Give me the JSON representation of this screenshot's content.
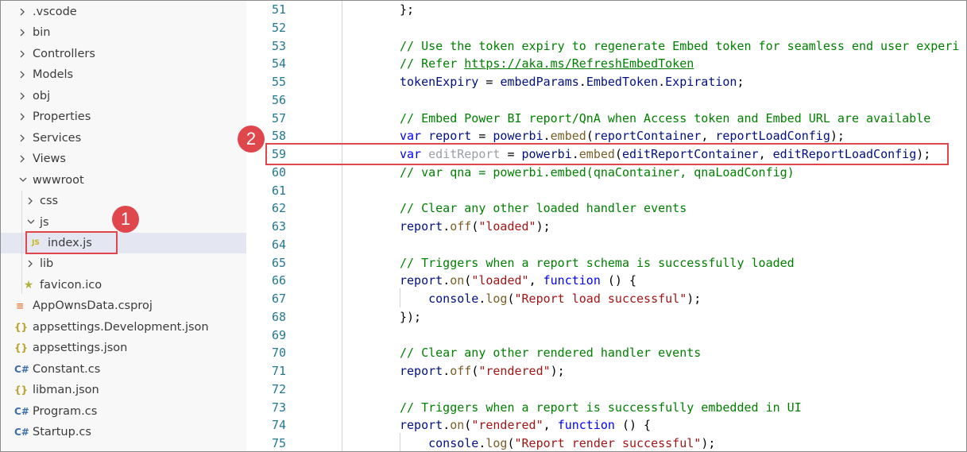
{
  "explorer": {
    "items": [
      {
        "label": ".vscode",
        "kind": "folder",
        "icon": "chevron-right-icon"
      },
      {
        "label": "bin",
        "kind": "folder",
        "icon": "chevron-right-icon"
      },
      {
        "label": "Controllers",
        "kind": "folder",
        "icon": "chevron-right-icon"
      },
      {
        "label": "Models",
        "kind": "folder",
        "icon": "chevron-right-icon"
      },
      {
        "label": "obj",
        "kind": "folder",
        "icon": "chevron-right-icon"
      },
      {
        "label": "Properties",
        "kind": "folder",
        "icon": "chevron-right-icon"
      },
      {
        "label": "Services",
        "kind": "folder",
        "icon": "chevron-right-icon"
      },
      {
        "label": "Views",
        "kind": "folder",
        "icon": "chevron-right-icon"
      },
      {
        "label": "wwwroot",
        "kind": "folder-open",
        "icon": "chevron-down-icon"
      },
      {
        "label": "css",
        "kind": "folder",
        "icon": "chevron-right-icon"
      },
      {
        "label": "js",
        "kind": "folder-open",
        "icon": "chevron-down-icon"
      },
      {
        "label": "index.js",
        "kind": "file",
        "icon": "javascript-file-icon",
        "icon_text": "JS"
      },
      {
        "label": "lib",
        "kind": "folder",
        "icon": "chevron-right-icon"
      },
      {
        "label": "favicon.ico",
        "kind": "file",
        "icon": "star-icon",
        "icon_text": "★"
      },
      {
        "label": "AppOwnsData.csproj",
        "kind": "file",
        "icon": "rss-icon",
        "icon_text": "≡"
      },
      {
        "label": "appsettings.Development.json",
        "kind": "file",
        "icon": "json-braces-icon",
        "icon_text": "{}"
      },
      {
        "label": "appsettings.json",
        "kind": "file",
        "icon": "json-braces-icon",
        "icon_text": "{}"
      },
      {
        "label": "Constant.cs",
        "kind": "file",
        "icon": "csharp-file-icon",
        "icon_text": "C#"
      },
      {
        "label": "libman.json",
        "kind": "file",
        "icon": "json-braces-icon",
        "icon_text": "{}"
      },
      {
        "label": "Program.cs",
        "kind": "file",
        "icon": "csharp-file-icon",
        "icon_text": "C#"
      },
      {
        "label": "Startup.cs",
        "kind": "file",
        "icon": "csharp-file-icon",
        "icon_text": "C#"
      }
    ]
  },
  "editor": {
    "lines": [
      {
        "n": "51",
        "tokens": [
          {
            "t": "};",
            "c": "plain"
          }
        ]
      },
      {
        "n": "52",
        "tokens": []
      },
      {
        "n": "53",
        "tokens": [
          {
            "t": "// Use the token expiry to regenerate Embed token for seamless end user experi",
            "c": "comment"
          }
        ]
      },
      {
        "n": "54",
        "tokens": [
          {
            "t": "// Refer ",
            "c": "comment"
          },
          {
            "t": "https://aka.ms/RefreshEmbedToken",
            "c": "link"
          }
        ]
      },
      {
        "n": "55",
        "tokens": [
          {
            "t": "tokenExpiry",
            "c": "var"
          },
          {
            "t": " = ",
            "c": "plain"
          },
          {
            "t": "embedParams",
            "c": "var"
          },
          {
            "t": ".",
            "c": "plain"
          },
          {
            "t": "EmbedToken",
            "c": "var"
          },
          {
            "t": ".",
            "c": "plain"
          },
          {
            "t": "Expiration",
            "c": "var"
          },
          {
            "t": ";",
            "c": "plain"
          }
        ]
      },
      {
        "n": "56",
        "tokens": []
      },
      {
        "n": "57",
        "tokens": [
          {
            "t": "// Embed Power BI report/QnA when Access token and Embed URL are available",
            "c": "comment"
          }
        ]
      },
      {
        "n": "58",
        "tokens": [
          {
            "t": "var",
            "c": "keyword"
          },
          {
            "t": " ",
            "c": "plain"
          },
          {
            "t": "report",
            "c": "var"
          },
          {
            "t": " = ",
            "c": "plain"
          },
          {
            "t": "powerbi",
            "c": "var"
          },
          {
            "t": ".",
            "c": "plain"
          },
          {
            "t": "embed",
            "c": "fn"
          },
          {
            "t": "(",
            "c": "plain"
          },
          {
            "t": "reportContainer",
            "c": "var"
          },
          {
            "t": ", ",
            "c": "plain"
          },
          {
            "t": "reportLoadConfig",
            "c": "var"
          },
          {
            "t": ");",
            "c": "plain"
          }
        ]
      },
      {
        "n": "59",
        "tokens": [
          {
            "t": "var",
            "c": "keyword"
          },
          {
            "t": " ",
            "c": "plain"
          },
          {
            "t": "editReport",
            "c": "dim"
          },
          {
            "t": " = ",
            "c": "plain"
          },
          {
            "t": "powerbi",
            "c": "var"
          },
          {
            "t": ".",
            "c": "plain"
          },
          {
            "t": "embed",
            "c": "fn"
          },
          {
            "t": "(",
            "c": "plain"
          },
          {
            "t": "editReportContainer",
            "c": "var"
          },
          {
            "t": ", ",
            "c": "plain"
          },
          {
            "t": "editReportLoadConfig",
            "c": "var"
          },
          {
            "t": ");",
            "c": "plain"
          }
        ]
      },
      {
        "n": "60",
        "tokens": [
          {
            "t": "// var qna = powerbi.embed(qnaContainer, qnaLoadConfig)",
            "c": "comment"
          }
        ]
      },
      {
        "n": "61",
        "tokens": []
      },
      {
        "n": "62",
        "tokens": [
          {
            "t": "// Clear any other loaded handler events",
            "c": "comment"
          }
        ]
      },
      {
        "n": "63",
        "tokens": [
          {
            "t": "report",
            "c": "var"
          },
          {
            "t": ".",
            "c": "plain"
          },
          {
            "t": "off",
            "c": "fn"
          },
          {
            "t": "(",
            "c": "plain"
          },
          {
            "t": "\"loaded\"",
            "c": "string"
          },
          {
            "t": ");",
            "c": "plain"
          }
        ]
      },
      {
        "n": "64",
        "tokens": []
      },
      {
        "n": "65",
        "tokens": [
          {
            "t": "// Triggers when a report schema is successfully loaded",
            "c": "comment"
          }
        ]
      },
      {
        "n": "66",
        "tokens": [
          {
            "t": "report",
            "c": "var"
          },
          {
            "t": ".",
            "c": "plain"
          },
          {
            "t": "on",
            "c": "fn"
          },
          {
            "t": "(",
            "c": "plain"
          },
          {
            "t": "\"loaded\"",
            "c": "string"
          },
          {
            "t": ", ",
            "c": "plain"
          },
          {
            "t": "function",
            "c": "keyword"
          },
          {
            "t": " () {",
            "c": "plain"
          }
        ]
      },
      {
        "n": "67",
        "tokens": [
          {
            "t": "    ",
            "c": "plain"
          },
          {
            "t": "console",
            "c": "var"
          },
          {
            "t": ".",
            "c": "plain"
          },
          {
            "t": "log",
            "c": "fn"
          },
          {
            "t": "(",
            "c": "plain"
          },
          {
            "t": "\"Report load successful\"",
            "c": "string"
          },
          {
            "t": ");",
            "c": "plain"
          }
        ]
      },
      {
        "n": "68",
        "tokens": [
          {
            "t": "});",
            "c": "plain"
          }
        ]
      },
      {
        "n": "69",
        "tokens": []
      },
      {
        "n": "70",
        "tokens": [
          {
            "t": "// Clear any other rendered handler events",
            "c": "comment"
          }
        ]
      },
      {
        "n": "71",
        "tokens": [
          {
            "t": "report",
            "c": "var"
          },
          {
            "t": ".",
            "c": "plain"
          },
          {
            "t": "off",
            "c": "fn"
          },
          {
            "t": "(",
            "c": "plain"
          },
          {
            "t": "\"rendered\"",
            "c": "string"
          },
          {
            "t": ");",
            "c": "plain"
          }
        ]
      },
      {
        "n": "72",
        "tokens": []
      },
      {
        "n": "73",
        "tokens": [
          {
            "t": "// Triggers when a report is successfully embedded in UI",
            "c": "comment"
          }
        ]
      },
      {
        "n": "74",
        "tokens": [
          {
            "t": "report",
            "c": "var"
          },
          {
            "t": ".",
            "c": "plain"
          },
          {
            "t": "on",
            "c": "fn"
          },
          {
            "t": "(",
            "c": "plain"
          },
          {
            "t": "\"rendered\"",
            "c": "string"
          },
          {
            "t": ", ",
            "c": "plain"
          },
          {
            "t": "function",
            "c": "keyword"
          },
          {
            "t": " () {",
            "c": "plain"
          }
        ]
      },
      {
        "n": "75",
        "tokens": [
          {
            "t": "    ",
            "c": "plain"
          },
          {
            "t": "console",
            "c": "var"
          },
          {
            "t": ".",
            "c": "plain"
          },
          {
            "t": "log",
            "c": "fn"
          },
          {
            "t": "(",
            "c": "plain"
          },
          {
            "t": "\"Report render successful\"",
            "c": "string"
          },
          {
            "t": ");",
            "c": "plain"
          }
        ]
      }
    ]
  },
  "annotations": {
    "step1": "1",
    "step2": "2",
    "accent": "#e0474c"
  },
  "colors": {
    "comment": "#008000",
    "keyword": "#0000ff",
    "variable": "#001080",
    "function": "#795e26",
    "string": "#a31515",
    "line_number": "#237893",
    "selected_row": "#e4e6f1"
  }
}
